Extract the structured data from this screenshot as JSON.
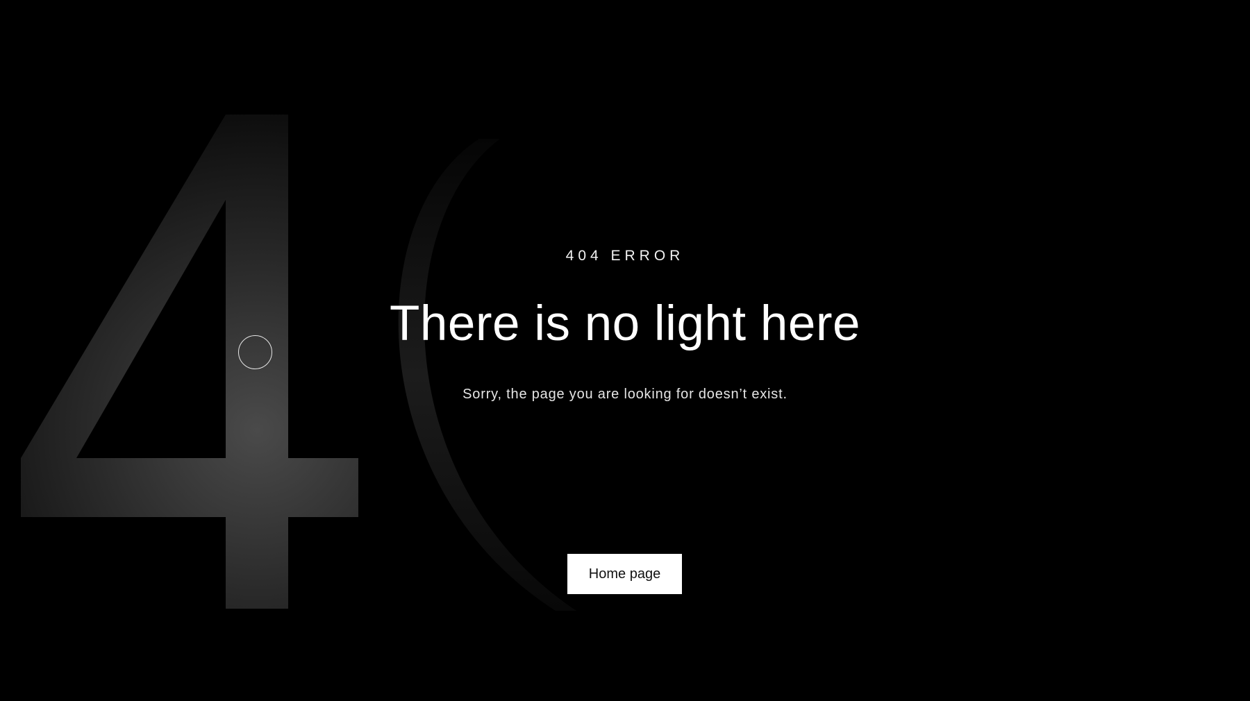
{
  "background": {
    "digits": "40",
    "colors": {
      "page": "#000000",
      "glyph_light": "#3a3a3a"
    }
  },
  "error": {
    "eyebrow": "404 ERROR",
    "title": "There is no light here",
    "message": "Sorry, the page you are looking for doesn’t exist.",
    "home_button_label": "Home page"
  }
}
